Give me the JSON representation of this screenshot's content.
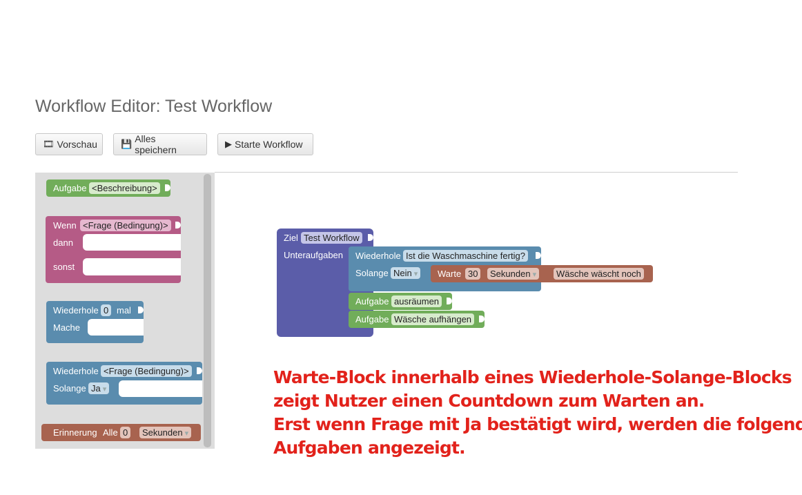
{
  "page": {
    "title": "Workflow Editor: Test Workflow"
  },
  "toolbar": {
    "preview_label": "Vorschau",
    "save_label": "Alles speichern",
    "start_label": "Starte Workflow"
  },
  "toolbox": {
    "task": {
      "label": "Aufgabe",
      "field": "<Beschreibung>"
    },
    "if_block": {
      "label": "Wenn",
      "field": "<Frage (Bedingung)>",
      "then": "dann",
      "else": "sonst"
    },
    "repeat_times": {
      "label": "Wiederhole",
      "count": "0",
      "suffix": "mal",
      "do": "Mache"
    },
    "repeat_while": {
      "label": "Wiederhole",
      "field": "<Frage (Bedingung)>",
      "while": "Solange",
      "option": "Ja"
    },
    "reminder": {
      "label": "Erinnerung",
      "every": "Alle",
      "count": "0",
      "unit": "Sekunden"
    }
  },
  "workspace": {
    "goal": {
      "label": "Ziel",
      "name": "Test Workflow",
      "subtasks": "Unteraufgaben"
    },
    "repeat": {
      "label": "Wiederhole",
      "question": "Ist die Waschmaschine fertig?",
      "while": "Solange",
      "option": "Nein"
    },
    "wait": {
      "label": "Warte",
      "count": "30",
      "unit": "Sekunden",
      "message": "Wäsche wäscht noch"
    },
    "task1": {
      "label": "Aufgabe",
      "text": "ausräumen"
    },
    "task2": {
      "label": "Aufgabe",
      "text": "Wäsche aufhängen"
    }
  },
  "caption": {
    "line1": "Warte-Block innerhalb eines Wiederhole-Solange-Blocks",
    "line2": "zeigt Nutzer einen Countdown zum Warten an.",
    "line3": "Erst wenn Frage mit Ja bestätigt wird, werden die folgenden",
    "line4": "Aufgaben angezeigt."
  },
  "colors": {
    "task": "#71ad5a",
    "if": "#b55b86",
    "loop": "#5a8cae",
    "wait": "#a8634f",
    "goal": "#5b5da9",
    "caption": "#e2221b"
  }
}
